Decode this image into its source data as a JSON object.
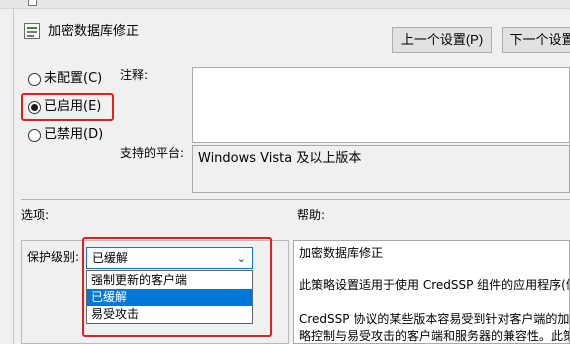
{
  "window": {
    "policy_title": "加密数据库修正"
  },
  "nav": {
    "prev_label": "上一个设置(P)",
    "next_label": "下一个设置"
  },
  "state": {
    "options": [
      {
        "label": "未配置(C)",
        "checked": false
      },
      {
        "label": "已启用(E)",
        "checked": true
      },
      {
        "label": "已禁用(D)",
        "checked": false
      }
    ]
  },
  "comment": {
    "label": "注释:",
    "value": ""
  },
  "platform": {
    "label": "支持的平台:",
    "value": "Windows Vista 及以上版本"
  },
  "sections": {
    "options_label": "选项:",
    "help_label": "帮助:"
  },
  "protection": {
    "label": "保护级别:",
    "selected": "已缓解",
    "choices": [
      "强制更新的客户端",
      "已缓解",
      "易受攻击"
    ],
    "highlighted_index": 1
  },
  "help": {
    "lines": [
      "加密数据库修正",
      "",
      "此策略设置适用于使用 CredSSP 组件的应用程序(例",
      "",
      "CredSSP 协议的某些版本容易受到针对客户端的加密",
      "略控制与易受攻击的客户端和服务器的兼容性。此策"
    ]
  },
  "colors": {
    "highlight_box": "#e0201f",
    "selection": "#0078d7"
  },
  "icons": {
    "policy": "policy-settings-icon",
    "dropdown": "chevron-down-icon"
  }
}
